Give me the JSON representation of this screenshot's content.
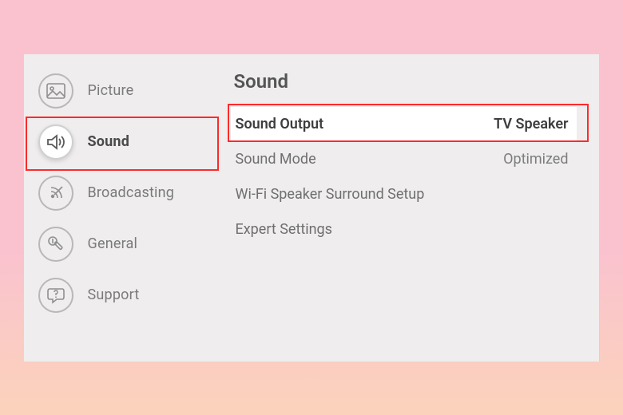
{
  "sidebar": {
    "items": [
      {
        "label": "Picture"
      },
      {
        "label": "Sound"
      },
      {
        "label": "Broadcasting"
      },
      {
        "label": "General"
      },
      {
        "label": "Support"
      }
    ],
    "selected_index": 1
  },
  "content": {
    "title": "Sound",
    "rows": [
      {
        "label": "Sound Output",
        "value": "TV Speaker"
      },
      {
        "label": "Sound Mode",
        "value": "Optimized"
      },
      {
        "label": "Wi-Fi Speaker Surround Setup",
        "value": ""
      },
      {
        "label": "Expert Settings",
        "value": ""
      }
    ],
    "highlighted_index": 0
  }
}
